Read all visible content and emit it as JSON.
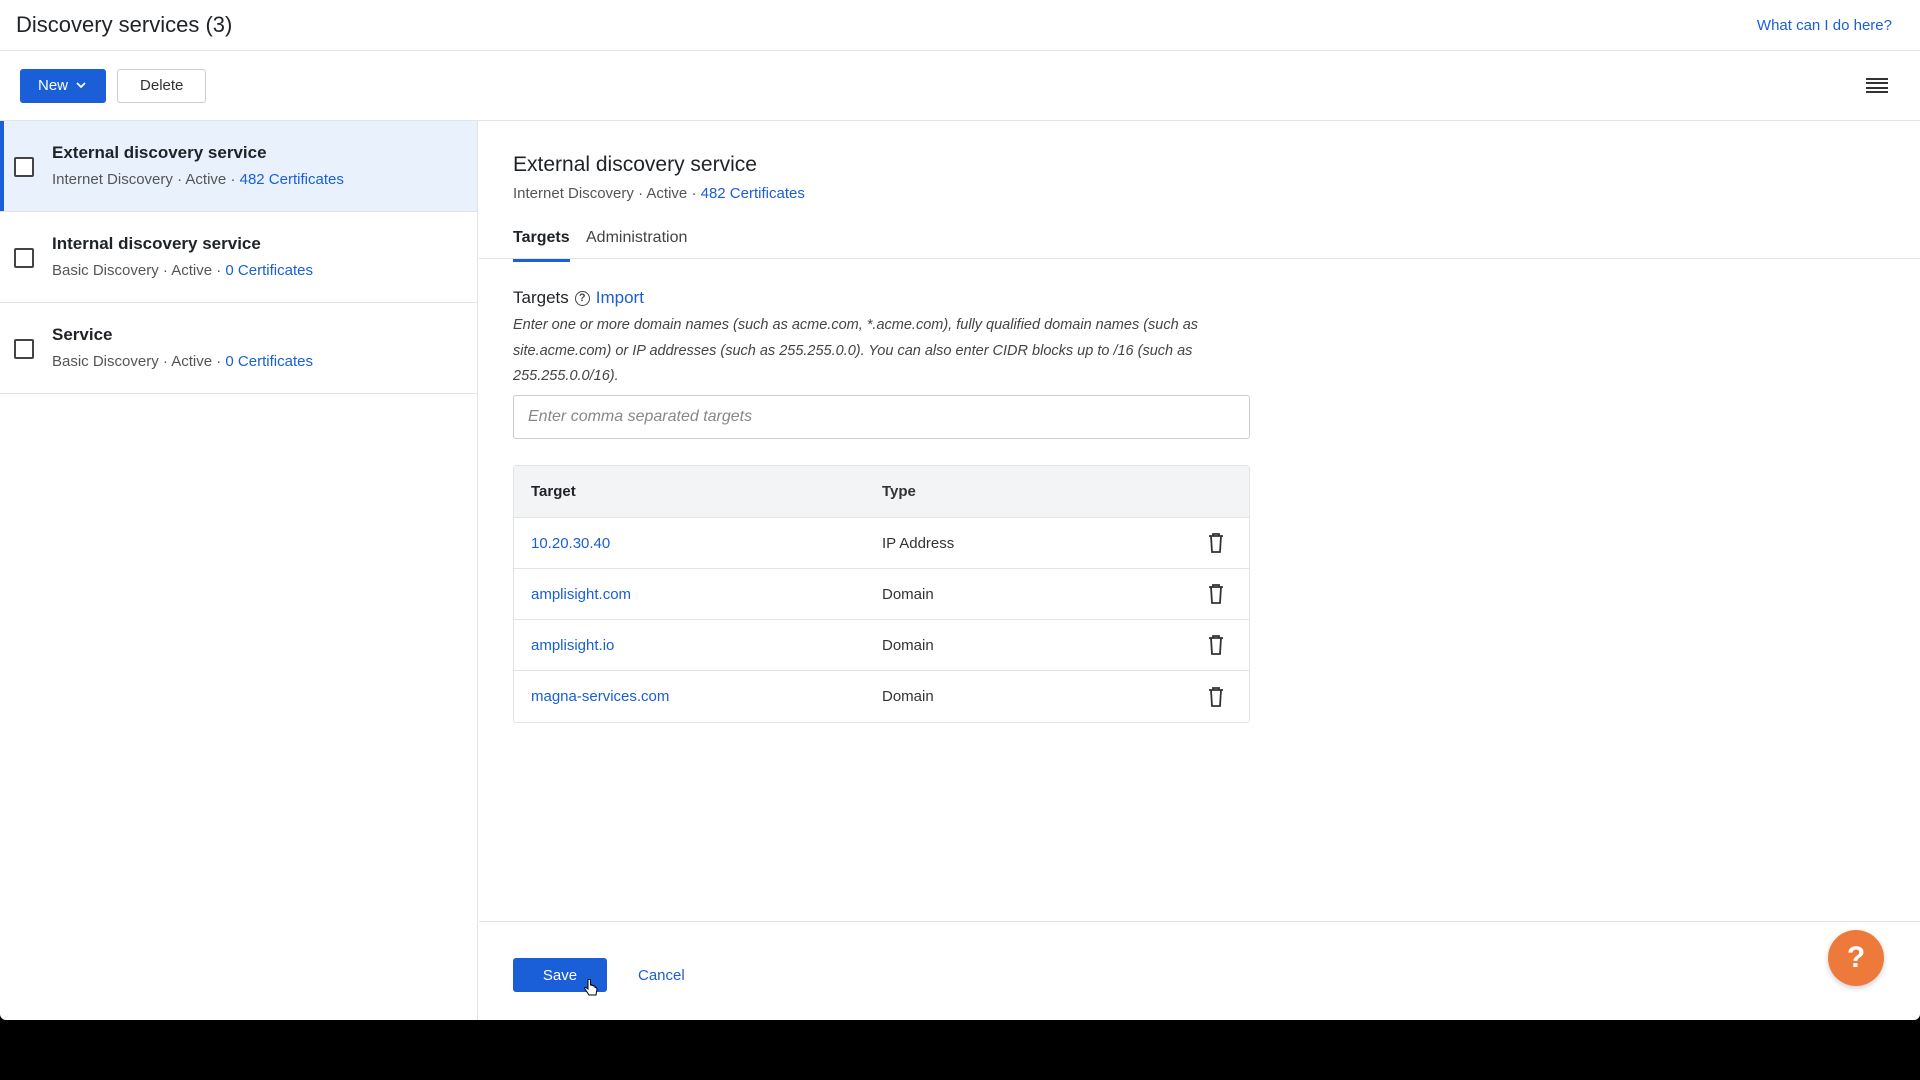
{
  "header": {
    "title": "Discovery services (3)",
    "help_link": "What can I do here?"
  },
  "toolbar": {
    "new_label": "New",
    "delete_label": "Delete"
  },
  "services": [
    {
      "name": "External discovery service",
      "type": "Internet Discovery",
      "status": "Active",
      "certs": "482 Certificates",
      "selected": true
    },
    {
      "name": "Internal discovery service",
      "type": "Basic Discovery",
      "status": "Active",
      "certs": "0 Certificates",
      "selected": false
    },
    {
      "name": "Service",
      "type": "Basic Discovery",
      "status": "Active",
      "certs": "0 Certificates",
      "selected": false
    }
  ],
  "separator": "·",
  "detail": {
    "title": "External discovery service",
    "type": "Internet Discovery",
    "status": "Active",
    "certs": "482 Certificates",
    "tabs": [
      {
        "label": "Targets",
        "active": true
      },
      {
        "label": "Administration",
        "active": false
      }
    ],
    "targets_label": "Targets",
    "help_glyph": "?",
    "import_label": "Import",
    "hint": "Enter one or more domain names (such as acme.com, *.acme.com), fully qualified domain names (such as site.acme.com) or IP addresses (such as 255.255.0.0). You can also enter CIDR blocks up to /16 (such as 255.255.0.0/16).",
    "input_placeholder": "Enter comma separated targets",
    "table": {
      "headers": {
        "target": "Target",
        "type": "Type"
      },
      "rows": [
        {
          "target": "10.20.30.40",
          "type": "IP Address"
        },
        {
          "target": "amplisight.com",
          "type": "Domain"
        },
        {
          "target": "amplisight.io",
          "type": "Domain"
        },
        {
          "target": "magna-services.com",
          "type": "Domain"
        }
      ]
    }
  },
  "footer": {
    "save_label": "Save",
    "cancel_label": "Cancel"
  },
  "help_fab": "?",
  "colors": {
    "accent": "#1a5ed8",
    "selected_bg": "#e9f1fd",
    "fab": "#ed7a3a"
  },
  "icons": {
    "new_dropdown": "chevron-down-icon",
    "menu": "hamburger-menu-icon",
    "row_action": "trash-icon",
    "help": "help-circle-icon"
  }
}
